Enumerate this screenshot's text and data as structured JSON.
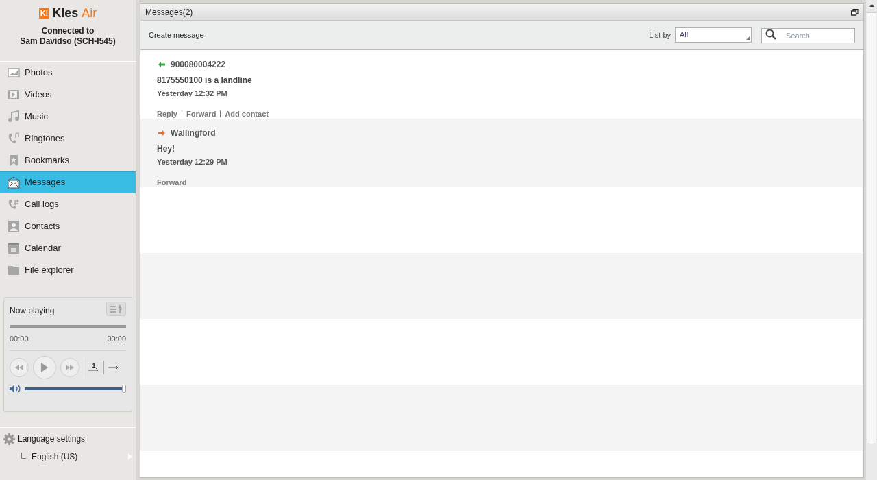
{
  "app": {
    "logo_mark": "K!",
    "logo_name": "Kies",
    "logo_suffix": "Air",
    "connection": "Connected to",
    "device": "Sam Davidso (SCH-I545)"
  },
  "sidebar": {
    "items": [
      {
        "label": "Photos",
        "kind": "photos",
        "selected": false
      },
      {
        "label": "Videos",
        "kind": "videos",
        "selected": false
      },
      {
        "label": "Music",
        "kind": "music",
        "selected": false
      },
      {
        "label": "Ringtones",
        "kind": "ringtones",
        "selected": false
      },
      {
        "label": "Bookmarks",
        "kind": "bookmarks",
        "selected": false
      },
      {
        "label": "Messages",
        "kind": "messages",
        "selected": true
      },
      {
        "label": "Call logs",
        "kind": "calllogs",
        "selected": false
      },
      {
        "label": "Contacts",
        "kind": "contacts",
        "selected": false
      },
      {
        "label": "Calendar",
        "kind": "calendar",
        "selected": false
      },
      {
        "label": "File explorer",
        "kind": "files",
        "selected": false
      }
    ]
  },
  "player": {
    "title": "Now playing",
    "elapsed": "00:00",
    "total": "00:00",
    "progress": {
      "level": 0
    },
    "volume": {
      "level": 1.0
    },
    "repeat_label": "1"
  },
  "language": {
    "title": "Language settings",
    "value": "English (US)"
  },
  "panel": {
    "title": "Messages(2)",
    "create": "Create message",
    "list_by_label": "List by",
    "list_by_value": "All",
    "search_placeholder": "Search"
  },
  "messages": [
    {
      "kind": "incoming",
      "sender": "900080004222",
      "body": "8175550100 is a landline",
      "time": "Yesterday 12:32 PM",
      "actions": [
        "Reply",
        "Forward",
        "Add contact"
      ]
    },
    {
      "kind": "outgoing",
      "sender": "Wallingford",
      "body": "Hey!",
      "time": "Yesterday 12:29 PM",
      "actions": [
        "Forward"
      ]
    }
  ]
}
